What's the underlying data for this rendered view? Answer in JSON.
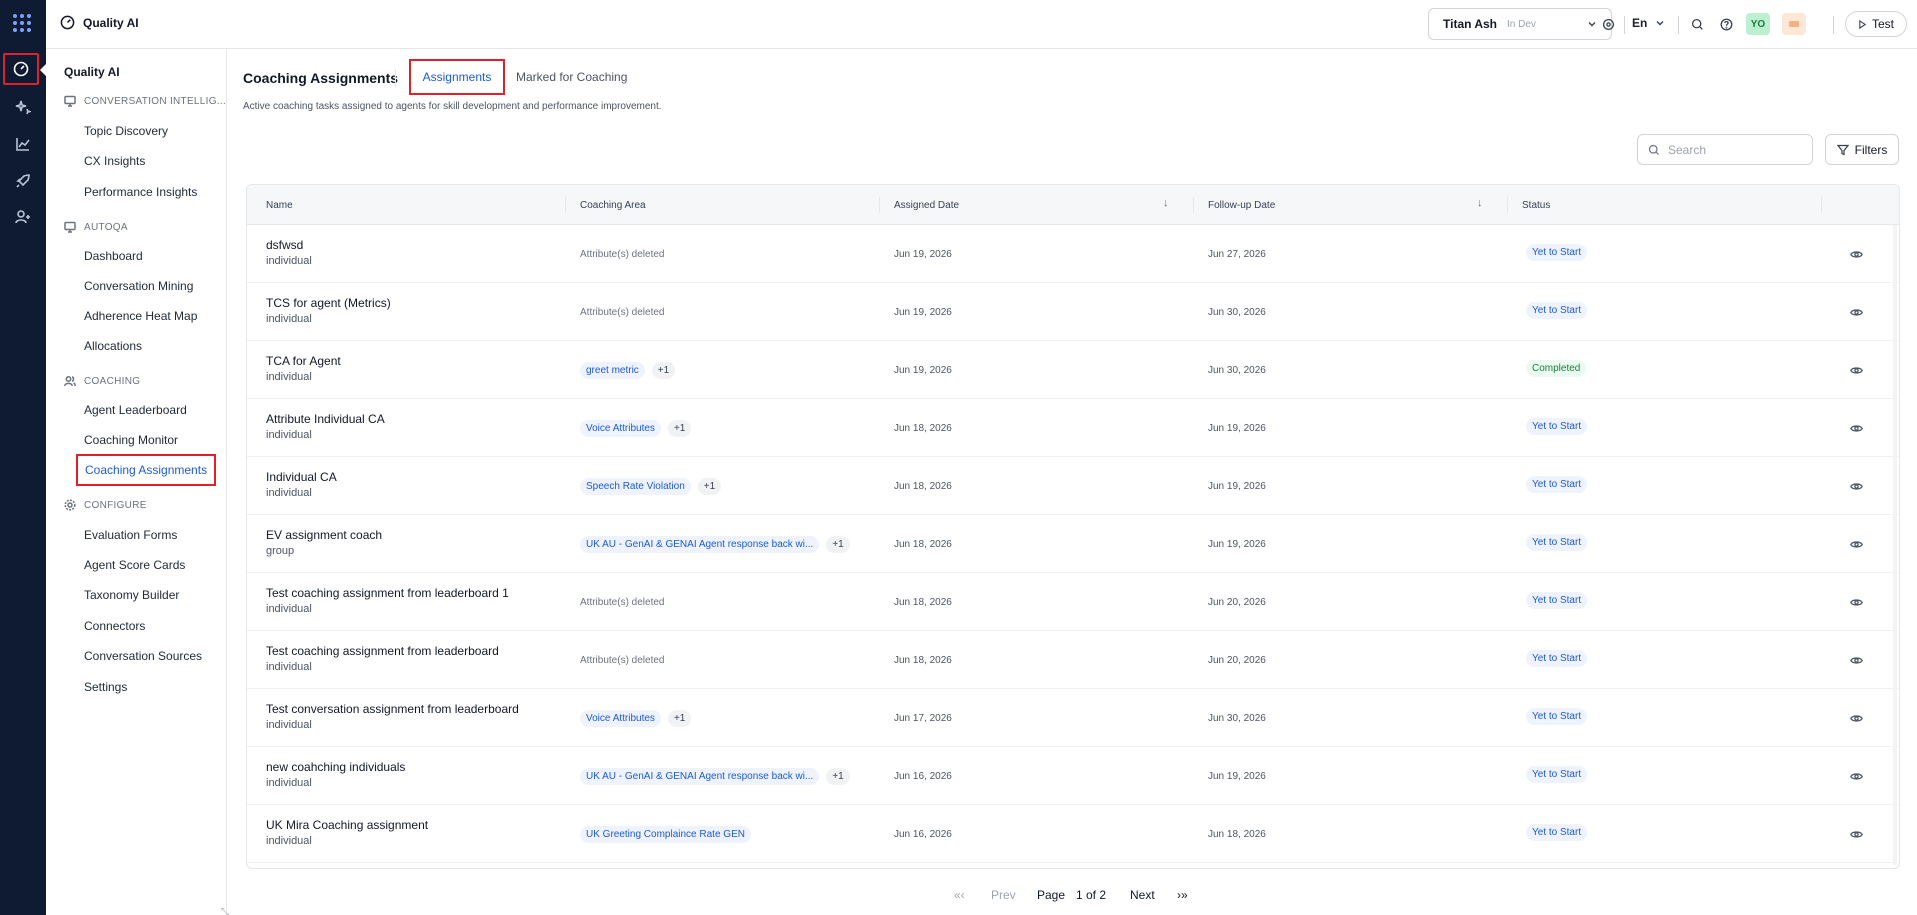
{
  "app": {
    "title": "Quality AI"
  },
  "topbar": {
    "org_name": "Titan Ash",
    "org_env": "In Dev",
    "language": "En",
    "avatar_initials": "YO",
    "test_label": "Test"
  },
  "sidebar": {
    "title": "Quality AI",
    "sections": {
      "conversation_intel": "CONVERSATION INTELLIG...",
      "autoqa": "AUTOQA",
      "coaching": "COACHING",
      "configure": "CONFIGURE"
    },
    "items": {
      "topic_discovery": "Topic Discovery",
      "cx_insights": "CX Insights",
      "performance_insights": "Performance Insights",
      "dashboard": "Dashboard",
      "conversation_mining": "Conversation Mining",
      "adherence_heat_map": "Adherence Heat Map",
      "allocations": "Allocations",
      "agent_leaderboard": "Agent Leaderboard",
      "coaching_monitor": "Coaching Monitor",
      "coaching_assignments": "Coaching Assignments",
      "evaluation_forms": "Evaluation Forms",
      "agent_score_cards": "Agent Score Cards",
      "taxonomy_builder": "Taxonomy Builder",
      "connectors": "Connectors",
      "conversation_sources": "Conversation Sources",
      "settings": "Settings"
    }
  },
  "main": {
    "title": "Coaching Assignments",
    "tabs": {
      "assignments": "Assignments",
      "marked": "Marked for Coaching"
    },
    "description": "Active coaching tasks assigned to agents for skill development and performance improvement.",
    "search_placeholder": "Search",
    "filters_label": "Filters"
  },
  "table": {
    "columns": {
      "name": "Name",
      "coaching_area": "Coaching Area",
      "assigned_date": "Assigned Date",
      "followup_date": "Follow-up Date",
      "status": "Status"
    },
    "rows": [
      {
        "name": "dsfwsd",
        "type": "individual",
        "area_deleted": "Attribute(s) deleted",
        "assigned": "Jun 19, 2026",
        "followup": "Jun 27, 2026",
        "status": "Yet to Start"
      },
      {
        "name": "TCS for agent (Metrics)",
        "type": "individual",
        "area_deleted": "Attribute(s) deleted",
        "assigned": "Jun 19, 2026",
        "followup": "Jun 30, 2026",
        "status": "Yet to Start"
      },
      {
        "name": "TCA for Agent",
        "type": "individual",
        "area_chip": "greet metric",
        "area_more": "+1",
        "assigned": "Jun 19, 2026",
        "followup": "Jun 30, 2026",
        "status": "Completed"
      },
      {
        "name": "Attribute Individual CA",
        "type": "individual",
        "area_chip": "Voice Attributes",
        "area_more": "+1",
        "assigned": "Jun 18, 2026",
        "followup": "Jun 19, 2026",
        "status": "Yet to Start"
      },
      {
        "name": "Individual CA",
        "type": "individual",
        "area_chip": "Speech Rate Violation",
        "area_more": "+1",
        "assigned": "Jun 18, 2026",
        "followup": "Jun 19, 2026",
        "status": "Yet to Start"
      },
      {
        "name": "EV assignment coach",
        "type": "group",
        "area_chip": "UK AU - GenAI & GENAI Agent response back wi...",
        "area_more": "+1",
        "assigned": "Jun 18, 2026",
        "followup": "Jun 19, 2026",
        "status": "Yet to Start"
      },
      {
        "name": "Test coaching assignment from leaderboard 1",
        "type": "individual",
        "area_deleted": "Attribute(s) deleted",
        "assigned": "Jun 18, 2026",
        "followup": "Jun 20, 2026",
        "status": "Yet to Start"
      },
      {
        "name": "Test coaching assignment from leaderboard",
        "type": "individual",
        "area_deleted": "Attribute(s) deleted",
        "assigned": "Jun 18, 2026",
        "followup": "Jun 20, 2026",
        "status": "Yet to Start"
      },
      {
        "name": "Test conversation assignment from leaderboard",
        "type": "individual",
        "area_chip": "Voice Attributes",
        "area_more": "+1",
        "assigned": "Jun 17, 2026",
        "followup": "Jun 30, 2026",
        "status": "Yet to Start"
      },
      {
        "name": "new coahching individuals",
        "type": "individual",
        "area_chip": "UK AU - GenAI & GENAI Agent response back wi...",
        "area_more": "+1",
        "assigned": "Jun 16, 2026",
        "followup": "Jun 19, 2026",
        "status": "Yet to Start"
      },
      {
        "name": "UK Mira Coaching assignment",
        "type": "individual",
        "area_chip": "UK Greeting Complaince Rate GEN",
        "assigned": "Jun 16, 2026",
        "followup": "Jun 18, 2026",
        "status": "Yet to Start"
      }
    ]
  },
  "pagination": {
    "first": "«‹",
    "prev": "Prev",
    "page_label": "Page",
    "page_value": "1 of 2",
    "next": "Next",
    "last": "›»"
  },
  "colors": {
    "rail_bg": "#0f1a33",
    "accent": "#1d5bd8",
    "highlight": "#e0202a",
    "completed": "#15803d"
  }
}
